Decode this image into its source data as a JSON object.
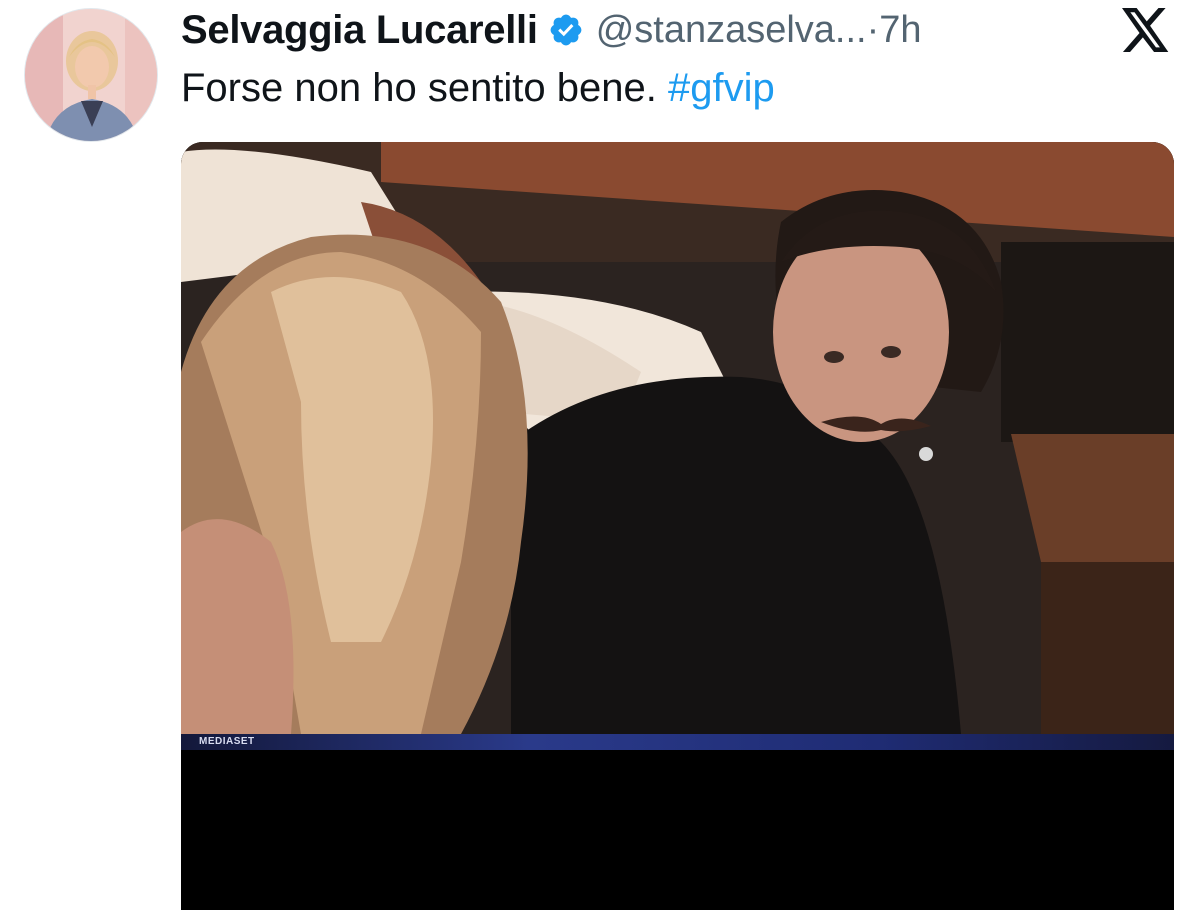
{
  "tweet": {
    "author": {
      "display_name": "Selvaggia Lucarelli",
      "verified": true,
      "handle": "@stanzaselva...",
      "avatar_icon": "profile-photo"
    },
    "separator": " · ",
    "time": "7h",
    "text": "Forse non ho sentito bene.",
    "hashtag": "#gfvip",
    "platform_icon": "x-logo-icon",
    "media": {
      "type": "video",
      "watermark": "MEDIASET"
    }
  },
  "colors": {
    "link": "#1d9bf0",
    "verified_badge": "#1d9bf0",
    "secondary_text": "#536471",
    "primary_text": "#0f1419"
  }
}
